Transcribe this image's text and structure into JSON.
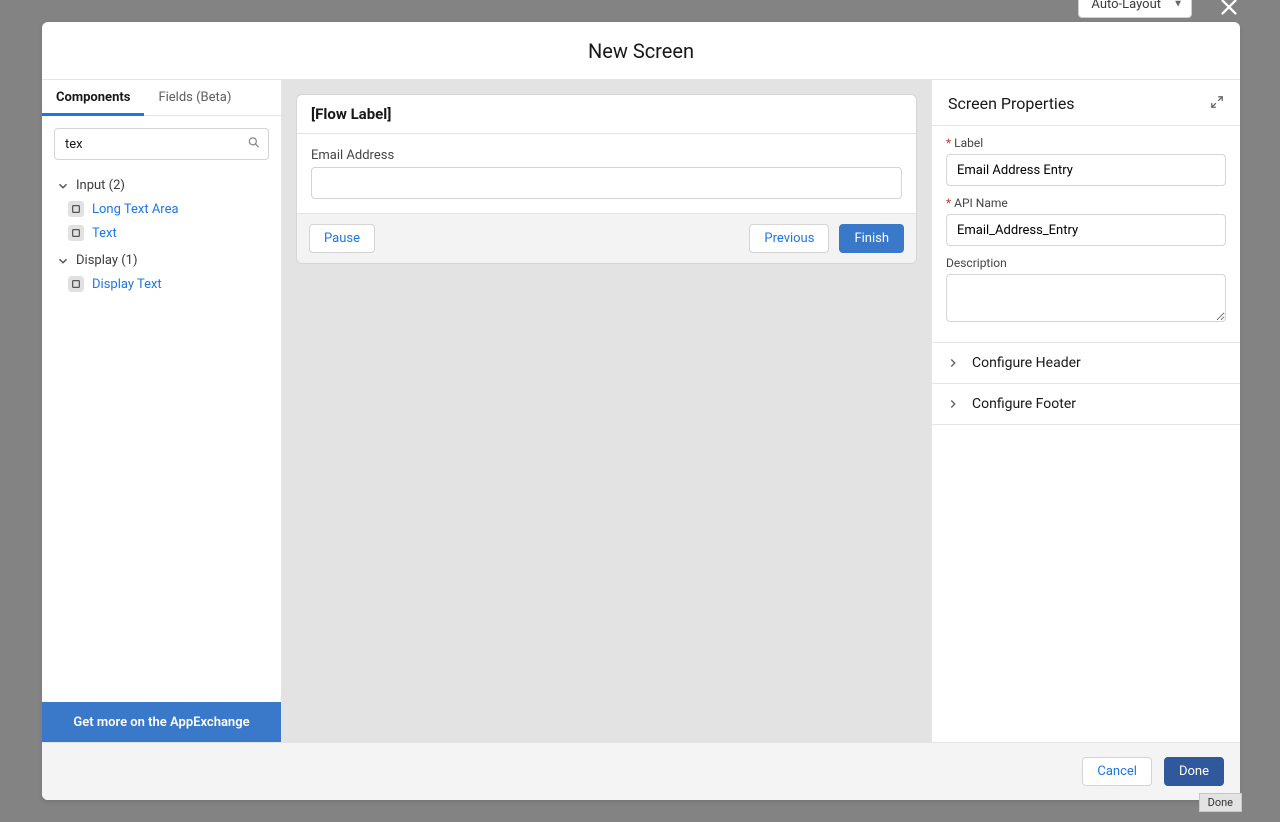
{
  "topbar": {
    "autolayout_label": "Auto-Layout"
  },
  "modal": {
    "title": "New Screen"
  },
  "sidebar": {
    "tabs": {
      "tab1": "Components",
      "tab2": "Fields (Beta)"
    },
    "search_value": "tex",
    "categories": [
      {
        "label": "Input (2)",
        "items": [
          {
            "label": "Long Text Area"
          },
          {
            "label": "Text"
          }
        ]
      },
      {
        "label": "Display (1)",
        "items": [
          {
            "label": "Display Text"
          }
        ]
      }
    ],
    "appexchange_label": "Get more on the AppExchange"
  },
  "canvas": {
    "card_header": "[Flow Label]",
    "field_label": "Email Address",
    "buttons": {
      "pause": "Pause",
      "previous": "Previous",
      "finish": "Finish"
    }
  },
  "properties": {
    "header": "Screen Properties",
    "labels": {
      "label": "Label",
      "api_name": "API Name",
      "description": "Description"
    },
    "values": {
      "label_value": "Email Address Entry",
      "api_name_value": "Email_Address_Entry",
      "description_value": ""
    },
    "accordion": {
      "header": "Configure Header",
      "footer": "Configure Footer"
    }
  },
  "footer_buttons": {
    "cancel": "Cancel",
    "done": "Done"
  },
  "tooltip": "Done"
}
